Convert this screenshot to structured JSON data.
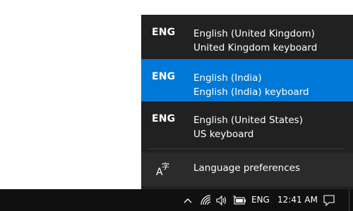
{
  "language_flyout": {
    "items": [
      {
        "code": "ENG",
        "language": "English (United Kingdom)",
        "keyboard": "United Kingdom keyboard",
        "selected": false
      },
      {
        "code": "ENG",
        "language": "English (India)",
        "keyboard": "English (India) keyboard",
        "selected": true
      },
      {
        "code": "ENG",
        "language": "English (United States)",
        "keyboard": "US keyboard",
        "selected": false
      }
    ],
    "preferences_label": "Language preferences",
    "preferences_icon": "language-settings-icon",
    "accent_color": "#0078d7",
    "background_color": "#212121"
  },
  "taskbar": {
    "input_indicator": "ENG",
    "time": "12:41 AM",
    "icons": [
      "chevron-up-icon",
      "wifi-icon",
      "volume-icon",
      "battery-icon",
      "notification-icon"
    ],
    "background_color": "#101010"
  }
}
